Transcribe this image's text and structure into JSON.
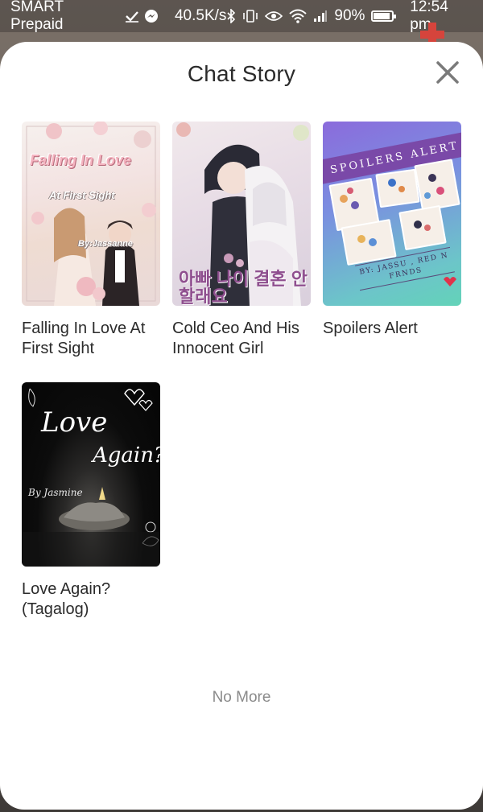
{
  "status_bar": {
    "carrier": "SMART Prepaid",
    "speed": "40.5K/s",
    "battery": "90%",
    "battery_level": 0.9,
    "time": "12:54 pm",
    "icons": [
      "check-icon",
      "messenger-icon",
      "bluetooth-icon",
      "vibrate-icon",
      "eye-icon",
      "wifi-icon",
      "signal-icon",
      "battery-icon"
    ]
  },
  "sheet": {
    "title": "Chat Story",
    "close_icon": "close-icon"
  },
  "stories": [
    {
      "title": "Falling In Love At First Sight",
      "cover_text": [
        "Falling In Love",
        "At First Sight",
        "By:Jassanne"
      ]
    },
    {
      "title": "Cold Ceo And His Innocent Girl",
      "cover_text": [
        "아빠 나이 결혼 안 할래요"
      ]
    },
    {
      "title": "Spoilers Alert",
      "cover_text": [
        "SPOILERS ALERT",
        "BY: JASSU , RED N FRNDS"
      ]
    },
    {
      "title": "Love Again? (Tagalog)",
      "cover_text": [
        "Love",
        "Again?",
        "By Jasmine"
      ]
    }
  ],
  "footer": {
    "end_text": "No More"
  },
  "colors": {
    "sheet_background": "#ffffff",
    "title_text": "#2b2b2b",
    "muted_text": "#8a8a8a",
    "close_icon": "#7a7a7a"
  }
}
